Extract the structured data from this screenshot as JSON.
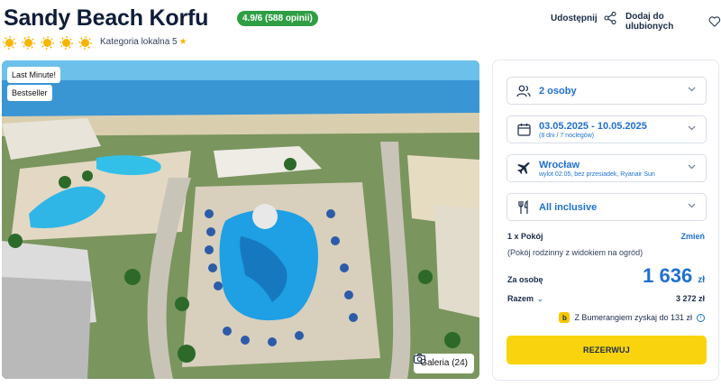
{
  "hotel": {
    "name": "Sandy Beach Korfu",
    "rating": "4.9/6 (588 opinii)",
    "category": "Kategoria lokalna 5",
    "sun_count": 5
  },
  "actions": {
    "share_label": "Udostępnij",
    "favorite_label": "Dodaj do ulubionych"
  },
  "gallery": {
    "badges": [
      "Last Minute!",
      "Bestseller"
    ],
    "gallery_label": "Galeria (24)"
  },
  "booking": {
    "guests": "2 osoby",
    "dates": "03.05.2025 - 10.05.2025",
    "dates_sub": "(8 dni / 7 noclegów)",
    "departure": "Wrocław",
    "departure_sub": "wylot 02:05, bez przesiadek, Ryanair Sun",
    "board": "All inclusive",
    "room_title": "1 x Pokój",
    "room_change": "Zmień",
    "room_desc": "(Pokój rodzinny z widokiem na ogród)",
    "per_person_label": "Za osobę",
    "price": "1 636",
    "currency": "zł",
    "total_label": "Razem",
    "total_value": "3 272 zł",
    "bonus_text": "Z Bumerangiem zyskaj do 131 zł",
    "reserve_label": "REZERWUJ"
  },
  "colors": {
    "accent": "#1f6fd1",
    "rating_bg": "#2f9e44",
    "reserve_bg": "#f9d30e",
    "sun": "#f7b500"
  }
}
